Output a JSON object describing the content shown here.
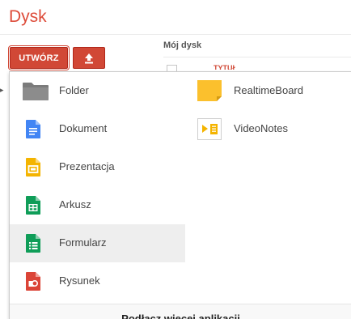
{
  "app": {
    "title": "Dysk"
  },
  "toolbar": {
    "create_label": "UTWÓRZ",
    "upload_icon": "upload-icon"
  },
  "location": {
    "title": "Mój dysk"
  },
  "colors": {
    "accent": "#dd4b39",
    "button": "#d14836",
    "hover_row": "#eeeeee",
    "folder": "#777777",
    "document": "#4285f4",
    "presentation": "#f4b400",
    "spreadsheet": "#0f9d58",
    "form": "#0f9d58",
    "drawing": "#db4437",
    "realtimeboard": "#fbc02d"
  },
  "create_menu": {
    "items_left": [
      {
        "label": "Folder",
        "icon": "folder-icon"
      },
      {
        "label": "Dokument",
        "icon": "document-icon"
      },
      {
        "label": "Prezentacja",
        "icon": "presentation-icon"
      },
      {
        "label": "Arkusz",
        "icon": "spreadsheet-icon"
      },
      {
        "label": "Formularz",
        "icon": "form-icon",
        "highlighted": true
      },
      {
        "label": "Rysunek",
        "icon": "drawing-icon"
      }
    ],
    "items_right": [
      {
        "label": "RealtimeBoard",
        "icon": "realtimeboard-icon"
      },
      {
        "label": "VideoNotes",
        "icon": "videonotes-icon"
      }
    ],
    "footer_label": "Podłącz więcej aplikacji"
  }
}
